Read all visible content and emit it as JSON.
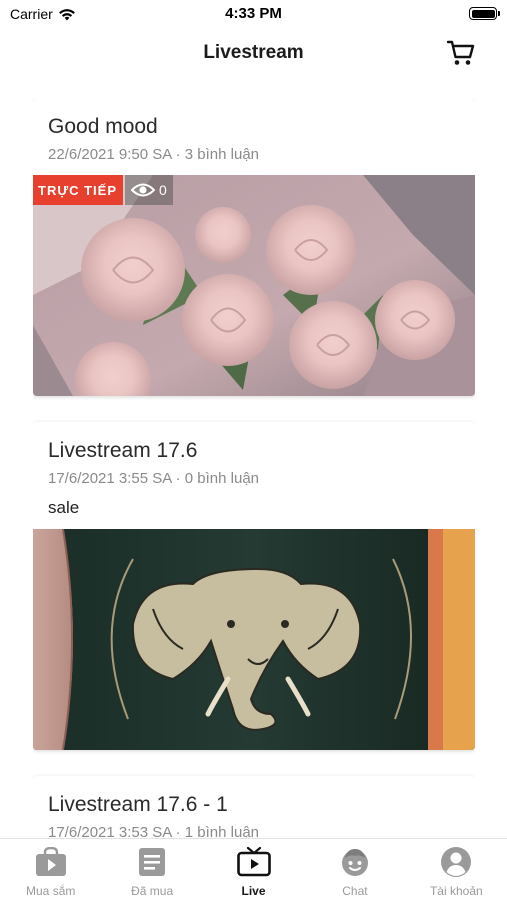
{
  "status_bar": {
    "carrier": "Carrier",
    "time": "4:33 PM",
    "icons": [
      "wifi-icon",
      "battery-icon"
    ]
  },
  "header": {
    "title": "Livestream",
    "cart_icon": "cart-icon"
  },
  "feed": {
    "cards": [
      {
        "title": "Good mood",
        "meta": "22/6/2021 9:50 SA · 3 bình luận",
        "description": "",
        "live_label": "TRỰC TIẾP",
        "view_count": "0",
        "thumbnail": "pink roses bouquet"
      },
      {
        "title": "Livestream 17.6",
        "meta": "17/6/2021 3:55 SA · 0 bình luận",
        "description": "sale",
        "thumbnail": "dark green can with elephant logo"
      },
      {
        "title": "Livestream 17.6 - 1",
        "meta": "17/6/2021 3:53 SA · 1 bình luận",
        "description": ""
      }
    ]
  },
  "tab_bar": {
    "active": "Live",
    "tabs": [
      {
        "label": "Mua sắm",
        "icon": "shopping-play-icon"
      },
      {
        "label": "Đã mua",
        "icon": "order-list-icon"
      },
      {
        "label": "Live",
        "icon": "tv-play-icon"
      },
      {
        "label": "Chat",
        "icon": "chat-face-icon"
      },
      {
        "label": "Tài khoản",
        "icon": "account-icon"
      }
    ]
  },
  "colors": {
    "live_badge": "#e8402f",
    "active_tab": "#1a1a1a",
    "inactive_tab": "#9a9a9a"
  }
}
